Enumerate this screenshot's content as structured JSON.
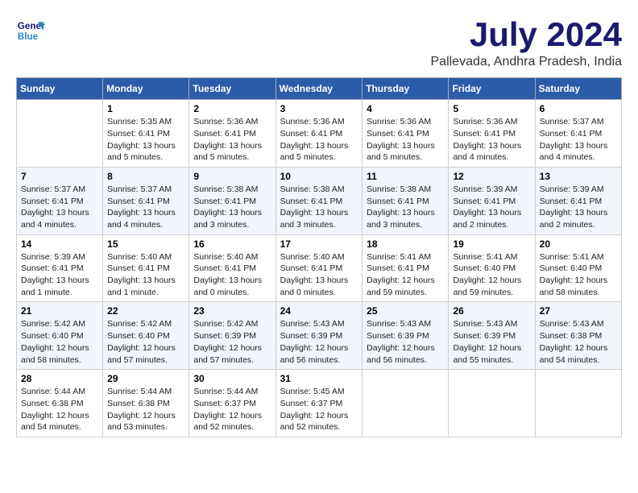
{
  "logo": {
    "line1": "General",
    "line2": "Blue"
  },
  "title": "July 2024",
  "location": "Pallevada, Andhra Pradesh, India",
  "headers": [
    "Sunday",
    "Monday",
    "Tuesday",
    "Wednesday",
    "Thursday",
    "Friday",
    "Saturday"
  ],
  "weeks": [
    [
      {
        "day": "",
        "info": ""
      },
      {
        "day": "1",
        "info": "Sunrise: 5:35 AM\nSunset: 6:41 PM\nDaylight: 13 hours\nand 5 minutes."
      },
      {
        "day": "2",
        "info": "Sunrise: 5:36 AM\nSunset: 6:41 PM\nDaylight: 13 hours\nand 5 minutes."
      },
      {
        "day": "3",
        "info": "Sunrise: 5:36 AM\nSunset: 6:41 PM\nDaylight: 13 hours\nand 5 minutes."
      },
      {
        "day": "4",
        "info": "Sunrise: 5:36 AM\nSunset: 6:41 PM\nDaylight: 13 hours\nand 5 minutes."
      },
      {
        "day": "5",
        "info": "Sunrise: 5:36 AM\nSunset: 6:41 PM\nDaylight: 13 hours\nand 4 minutes."
      },
      {
        "day": "6",
        "info": "Sunrise: 5:37 AM\nSunset: 6:41 PM\nDaylight: 13 hours\nand 4 minutes."
      }
    ],
    [
      {
        "day": "7",
        "info": "Sunrise: 5:37 AM\nSunset: 6:41 PM\nDaylight: 13 hours\nand 4 minutes."
      },
      {
        "day": "8",
        "info": "Sunrise: 5:37 AM\nSunset: 6:41 PM\nDaylight: 13 hours\nand 4 minutes."
      },
      {
        "day": "9",
        "info": "Sunrise: 5:38 AM\nSunset: 6:41 PM\nDaylight: 13 hours\nand 3 minutes."
      },
      {
        "day": "10",
        "info": "Sunrise: 5:38 AM\nSunset: 6:41 PM\nDaylight: 13 hours\nand 3 minutes."
      },
      {
        "day": "11",
        "info": "Sunrise: 5:38 AM\nSunset: 6:41 PM\nDaylight: 13 hours\nand 3 minutes."
      },
      {
        "day": "12",
        "info": "Sunrise: 5:39 AM\nSunset: 6:41 PM\nDaylight: 13 hours\nand 2 minutes."
      },
      {
        "day": "13",
        "info": "Sunrise: 5:39 AM\nSunset: 6:41 PM\nDaylight: 13 hours\nand 2 minutes."
      }
    ],
    [
      {
        "day": "14",
        "info": "Sunrise: 5:39 AM\nSunset: 6:41 PM\nDaylight: 13 hours\nand 1 minute."
      },
      {
        "day": "15",
        "info": "Sunrise: 5:40 AM\nSunset: 6:41 PM\nDaylight: 13 hours\nand 1 minute."
      },
      {
        "day": "16",
        "info": "Sunrise: 5:40 AM\nSunset: 6:41 PM\nDaylight: 13 hours\nand 0 minutes."
      },
      {
        "day": "17",
        "info": "Sunrise: 5:40 AM\nSunset: 6:41 PM\nDaylight: 13 hours\nand 0 minutes."
      },
      {
        "day": "18",
        "info": "Sunrise: 5:41 AM\nSunset: 6:41 PM\nDaylight: 12 hours\nand 59 minutes."
      },
      {
        "day": "19",
        "info": "Sunrise: 5:41 AM\nSunset: 6:40 PM\nDaylight: 12 hours\nand 59 minutes."
      },
      {
        "day": "20",
        "info": "Sunrise: 5:41 AM\nSunset: 6:40 PM\nDaylight: 12 hours\nand 58 minutes."
      }
    ],
    [
      {
        "day": "21",
        "info": "Sunrise: 5:42 AM\nSunset: 6:40 PM\nDaylight: 12 hours\nand 58 minutes."
      },
      {
        "day": "22",
        "info": "Sunrise: 5:42 AM\nSunset: 6:40 PM\nDaylight: 12 hours\nand 57 minutes."
      },
      {
        "day": "23",
        "info": "Sunrise: 5:42 AM\nSunset: 6:39 PM\nDaylight: 12 hours\nand 57 minutes."
      },
      {
        "day": "24",
        "info": "Sunrise: 5:43 AM\nSunset: 6:39 PM\nDaylight: 12 hours\nand 56 minutes."
      },
      {
        "day": "25",
        "info": "Sunrise: 5:43 AM\nSunset: 6:39 PM\nDaylight: 12 hours\nand 56 minutes."
      },
      {
        "day": "26",
        "info": "Sunrise: 5:43 AM\nSunset: 6:39 PM\nDaylight: 12 hours\nand 55 minutes."
      },
      {
        "day": "27",
        "info": "Sunrise: 5:43 AM\nSunset: 6:38 PM\nDaylight: 12 hours\nand 54 minutes."
      }
    ],
    [
      {
        "day": "28",
        "info": "Sunrise: 5:44 AM\nSunset: 6:38 PM\nDaylight: 12 hours\nand 54 minutes."
      },
      {
        "day": "29",
        "info": "Sunrise: 5:44 AM\nSunset: 6:38 PM\nDaylight: 12 hours\nand 53 minutes."
      },
      {
        "day": "30",
        "info": "Sunrise: 5:44 AM\nSunset: 6:37 PM\nDaylight: 12 hours\nand 52 minutes."
      },
      {
        "day": "31",
        "info": "Sunrise: 5:45 AM\nSunset: 6:37 PM\nDaylight: 12 hours\nand 52 minutes."
      },
      {
        "day": "",
        "info": ""
      },
      {
        "day": "",
        "info": ""
      },
      {
        "day": "",
        "info": ""
      }
    ]
  ]
}
